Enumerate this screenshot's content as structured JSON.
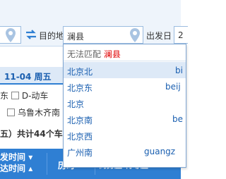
{
  "search": {
    "to_label": "目的地",
    "to_value": "澜县",
    "date_label": "出发日",
    "date_value": "2"
  },
  "results": {
    "date_tab": "11-04 周五",
    "filters_line1": {
      "prefix": "东",
      "checkbox_label": "D-动车"
    },
    "filters_line2": {
      "checkbox_label": "乌鲁木齐南"
    },
    "summary": {
      "prefix": "五）共计",
      "count": "44",
      "suffix": "个车次"
    }
  },
  "table_header": {
    "depart_label": "发时间",
    "arrive_label": "达时间",
    "duration_label": "历时",
    "seats_label": "商务座 特等座",
    "extra_label": "一"
  },
  "autocomplete": {
    "no_match_prefix": "无法匹配",
    "no_match_term": "澜县",
    "items": [
      {
        "name": "北京北",
        "pinyin": "bi",
        "selected": true
      },
      {
        "name": "北京东",
        "pinyin": "beij",
        "selected": false
      },
      {
        "name": "北京",
        "pinyin": "",
        "selected": false
      },
      {
        "name": "北京南",
        "pinyin": "be",
        "selected": false
      },
      {
        "name": "北京西",
        "pinyin": "",
        "selected": false
      },
      {
        "name": "广州南",
        "pinyin": "guangz",
        "selected": false
      }
    ]
  },
  "colors": {
    "accent_blue": "#2f7fd3",
    "highlight_red": "#e00000",
    "link_blue": "#1a5fb0"
  }
}
